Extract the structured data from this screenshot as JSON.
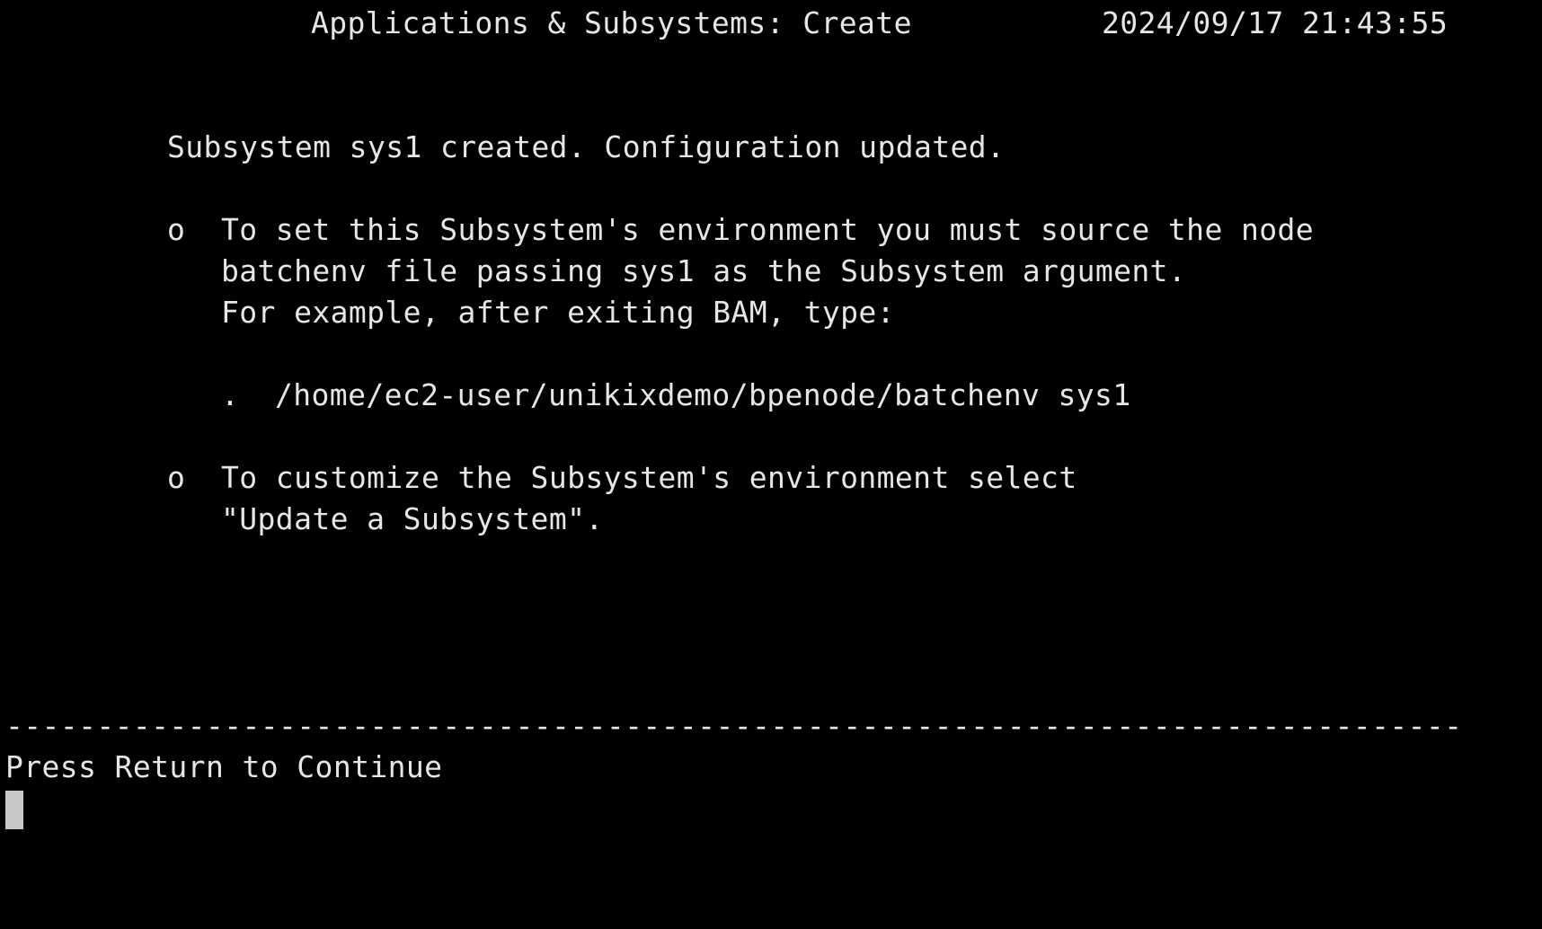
{
  "header": {
    "title": "Applications & Subsystems: Create",
    "timestamp": "2024/09/17 21:43:55"
  },
  "message": {
    "status": "Subsystem sys1 created. Configuration updated."
  },
  "notes": [
    {
      "bullet": "o",
      "lines": [
        "To set this Subsystem's environment you must source the node",
        "batchenv file passing sys1 as the Subsystem argument.",
        "For example, after exiting BAM, type:"
      ],
      "command_prefix": ".",
      "command": "/home/ec2-user/unikixdemo/bpenode/batchenv sys1"
    },
    {
      "bullet": "o",
      "lines": [
        "To customize the Subsystem's environment select",
        "\"Update a Subsystem\"."
      ]
    }
  ],
  "footer": {
    "separator": "--------------------------------------------------------------------------------",
    "prompt": "Press Return to Continue"
  },
  "colors": {
    "background": "#000000",
    "foreground": "#e6e6e6",
    "cursor": "#c8c8c8"
  }
}
